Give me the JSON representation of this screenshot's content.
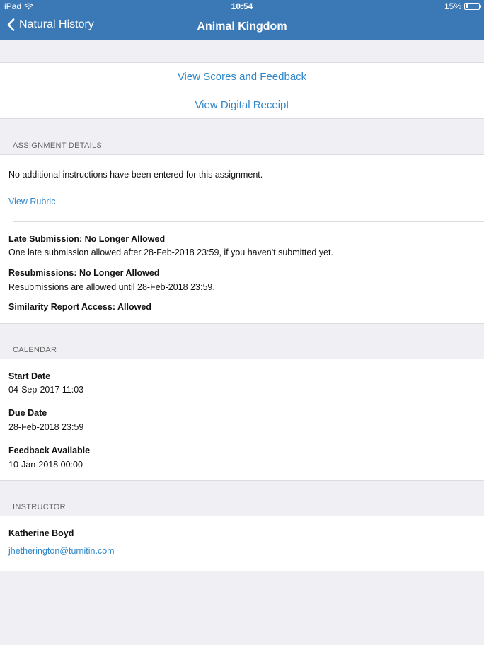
{
  "status": {
    "device": "iPad",
    "time": "10:54",
    "battery": "15%",
    "battery_level": 0.15
  },
  "nav": {
    "back_label": "Natural History",
    "title": "Animal Kingdom"
  },
  "actions": {
    "scores_label": "View Scores and Feedback",
    "receipt_label": "View Digital Receipt"
  },
  "assignment": {
    "header": "ASSIGNMENT DETAILS",
    "instructions": "No additional instructions have been entered for this assignment.",
    "rubric_link": "View Rubric",
    "late_title": "Late Submission: No Longer Allowed",
    "late_desc": "One late submission allowed after 28-Feb-2018 23:59, if you haven't submitted yet.",
    "resub_title": "Resubmissions: No Longer Allowed",
    "resub_desc": "Resubmissions are allowed until 28-Feb-2018 23:59.",
    "similarity": "Similarity Report Access: Allowed"
  },
  "calendar": {
    "header": "CALENDAR",
    "start_label": "Start Date",
    "start_value": "04-Sep-2017 11:03",
    "due_label": "Due Date",
    "due_value": "28-Feb-2018 23:59",
    "feedback_label": "Feedback Available",
    "feedback_value": "10-Jan-2018 00:00"
  },
  "instructor": {
    "header": "INSTRUCTOR",
    "name": "Katherine Boyd",
    "email": "jhetherington@turnitin.com"
  }
}
